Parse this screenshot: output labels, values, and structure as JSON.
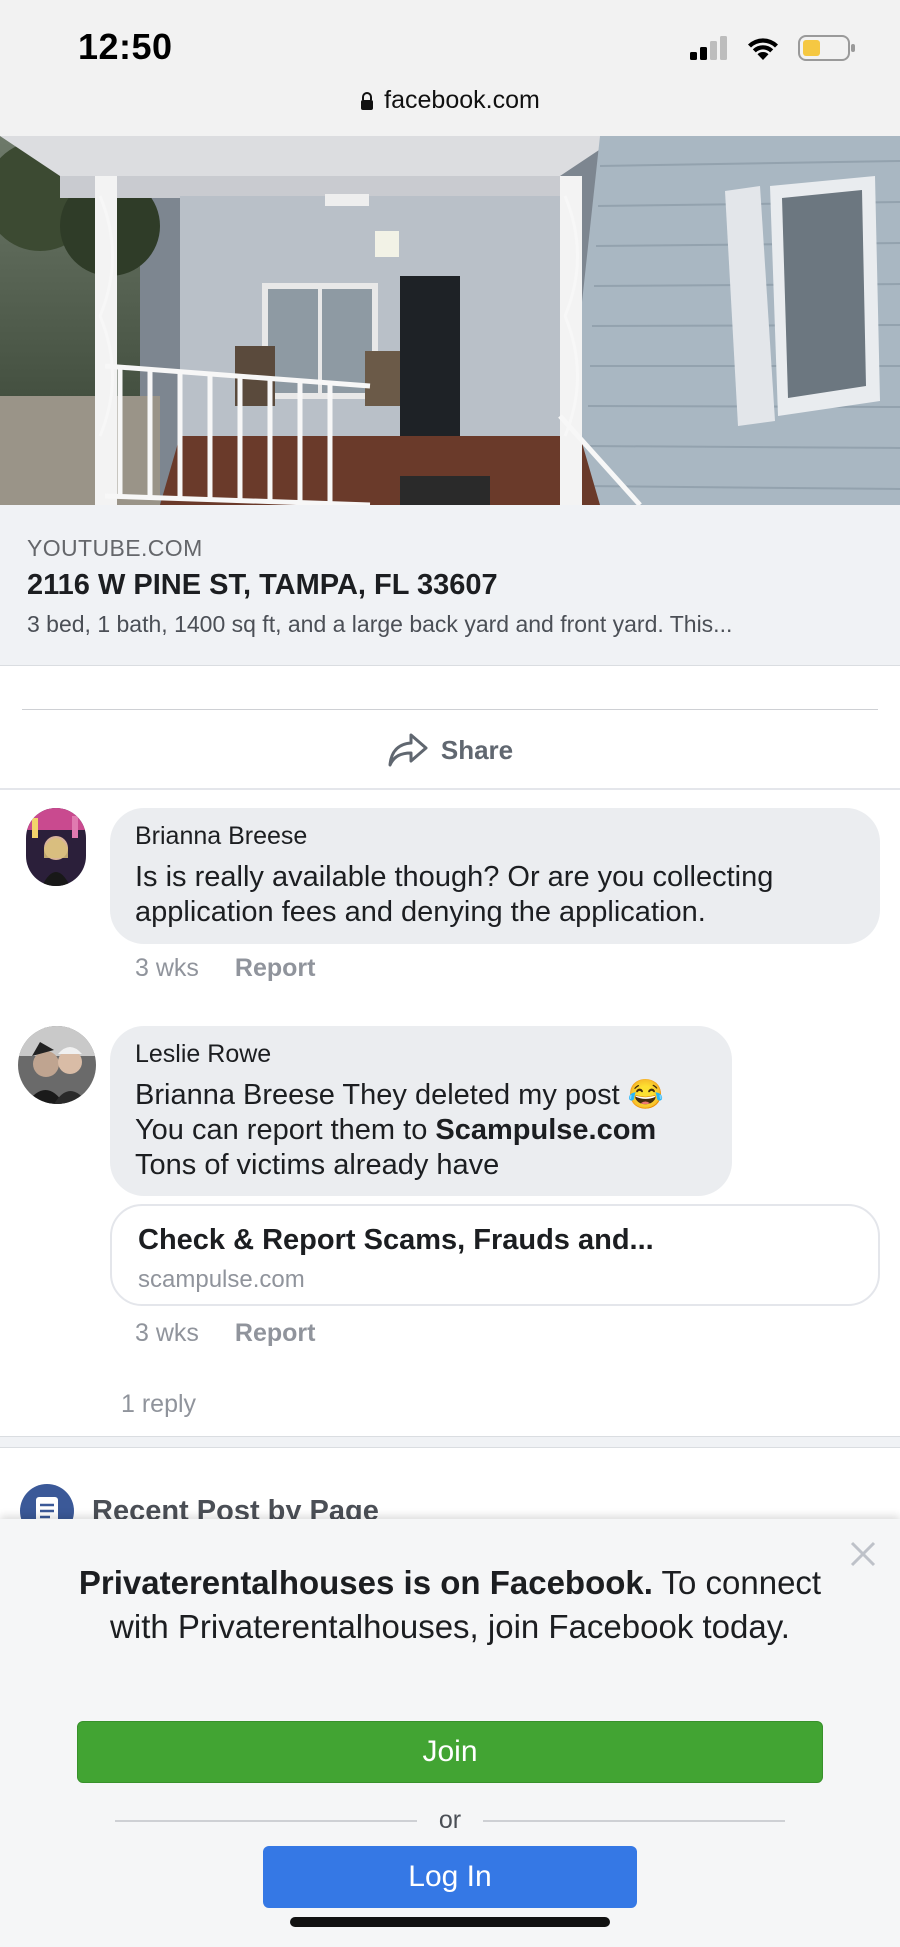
{
  "status_bar": {
    "time": "12:50",
    "url": "facebook.com",
    "icons": [
      "signal-icon",
      "wifi-icon",
      "battery-icon"
    ]
  },
  "link_preview": {
    "domain": "YOUTUBE.COM",
    "title": "2116 W PINE ST, TAMPA, FL 33607",
    "description": "3 bed, 1 bath, 1400 sq ft, and a large back yard and front yard. This..."
  },
  "actions": {
    "share_label": "Share"
  },
  "comments": [
    {
      "author": "Brianna Breese",
      "lines": [
        "Is is really available though? Or are you collecting",
        "application fees and denying the application."
      ],
      "time": "3 wks",
      "report": "Report"
    },
    {
      "author": "Leslie Rowe",
      "line1": "Brianna Breese They deleted my post",
      "emoji": "😂",
      "line2_prefix": "You can report them to ",
      "line2_link": "Scampulse.com",
      "line3": "Tons of victims already have",
      "link_card": {
        "title": "Check & Report Scams, Frauds and...",
        "domain": "scampulse.com"
      },
      "time": "3 wks",
      "report": "Report"
    }
  ],
  "replies_label": "1 reply",
  "recent_post_label": "Recent Post by Page",
  "overlay": {
    "bold": "Privaterentalhouses is on Facebook.",
    "rest": " To connect with Privaterentalhouses, join Facebook today.",
    "join_label": "Join",
    "or_label": "or",
    "login_label": "Log In"
  },
  "colors": {
    "join": "#42a433",
    "login": "#3578e5",
    "bubble": "#ebedf0"
  }
}
